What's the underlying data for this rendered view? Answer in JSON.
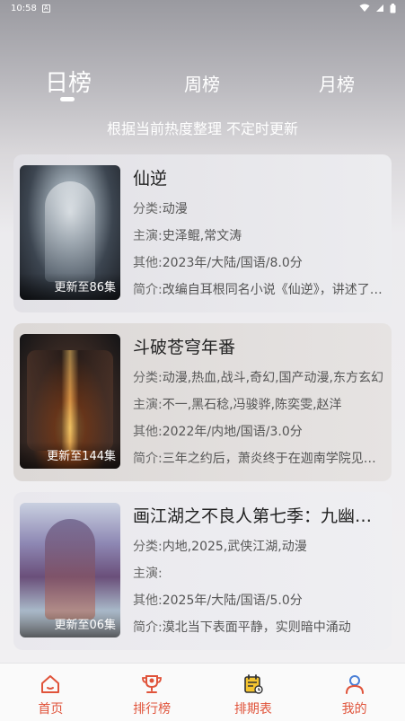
{
  "status_bar": {
    "time": "10:58",
    "a_icon": "A"
  },
  "tabs": [
    {
      "label": "日榜",
      "active": true
    },
    {
      "label": "周榜",
      "active": false
    },
    {
      "label": "月榜",
      "active": false
    }
  ],
  "subtitle": "根据当前热度整理 不定时更新",
  "labels": {
    "category": "分类:",
    "cast": "主演:",
    "other": "其他:",
    "intro": "简介:"
  },
  "items": [
    {
      "title": "仙逆",
      "category": "动漫",
      "cast": "史泽鲲,常文涛",
      "other": "2023年/大陆/国语/8.0分",
      "intro": "改编自耳根同名小说《仙逆》，讲述了乡村平凡少年王林",
      "episode": "更新至86集"
    },
    {
      "title": "斗破苍穹年番",
      "category": "动漫,热血,战斗,奇幻,国产动漫,东方玄幻",
      "cast": "不一,黑石稔,冯骏骅,陈奕雯,赵洋",
      "other": "2022年/内地/国语/3.0分",
      "intro": "三年之约后，萧炎终于在迦南学院见到了薰儿",
      "episode": "更新至144集"
    },
    {
      "title": "画江湖之不良人第七季：九幽玄天",
      "category": "内地,2025,武侠江湖,动漫",
      "cast": "",
      "other": "2025年/大陆/国语/5.0分",
      "intro": "漠北当下表面平静，实则暗中涌动",
      "episode": "更新至06集"
    }
  ],
  "nav": [
    {
      "label": "首页",
      "icon": "home-icon"
    },
    {
      "label": "排行榜",
      "icon": "trophy-icon"
    },
    {
      "label": "排期表",
      "icon": "calendar-icon"
    },
    {
      "label": "我的",
      "icon": "user-icon"
    }
  ],
  "colors": {
    "accent": "#e0533a",
    "calendar_fill": "#f4c430",
    "user_icon": "#4a7fd6"
  }
}
